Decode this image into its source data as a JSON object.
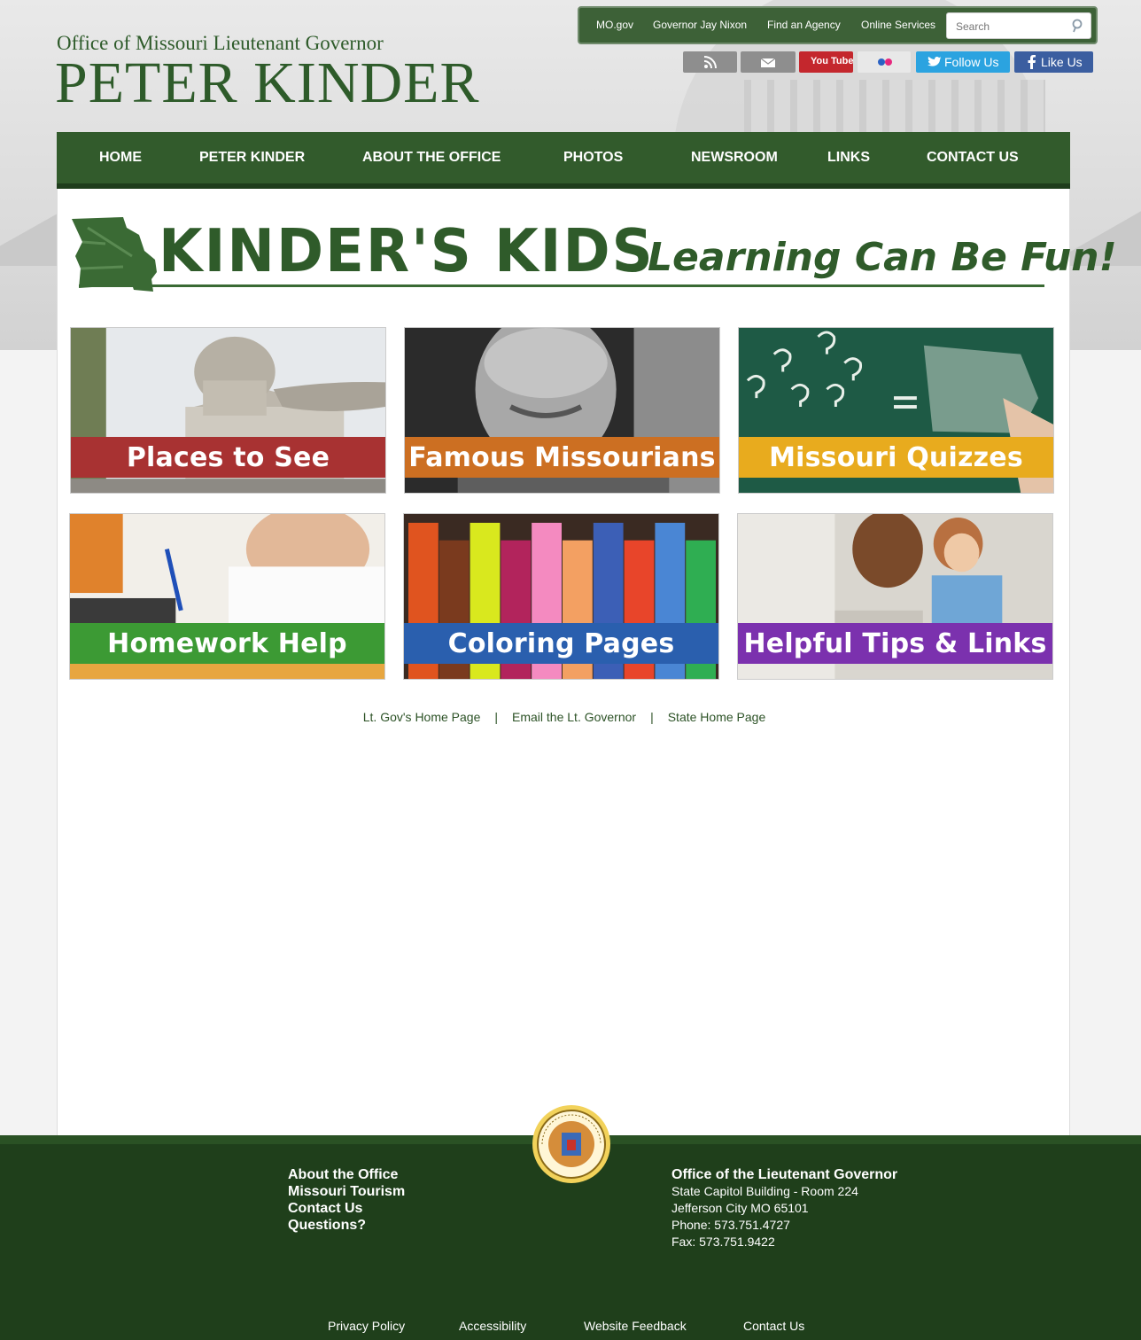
{
  "header": {
    "office_line": "Office of Missouri Lieutenant Governor",
    "name": "PETER KINDER",
    "utility_links": [
      "MO.gov",
      "Governor Jay Nixon",
      "Find an Agency",
      "Online Services"
    ],
    "search_placeholder": "Search",
    "social": {
      "rss": "rss-icon",
      "email": "email-icon",
      "youtube": "You Tube",
      "flickr": "flickr-icon",
      "twitter": "Follow Us",
      "facebook": "Like Us"
    }
  },
  "nav": [
    "HOME",
    "PETER KINDER",
    "ABOUT THE OFFICE",
    "PHOTOS",
    "NEWSROOM",
    "LINKS",
    "CONTACT US"
  ],
  "banner": {
    "title": "KINDER'S KIDS",
    "tagline": "Learning Can Be Fun!"
  },
  "tiles": [
    {
      "label": "Places to See",
      "color": "#a83232"
    },
    {
      "label": "Famous Missourians",
      "color": "#cc6f22"
    },
    {
      "label": "Missouri Quizzes",
      "color": "#e8ab1e"
    },
    {
      "label": "Homework Help",
      "color": "#3c9a34"
    },
    {
      "label": "Coloring Pages",
      "color": "#2a5fae"
    },
    {
      "label": "Helpful Tips & Links",
      "color": "#7b31ae"
    }
  ],
  "bottom_links": [
    "Lt. Gov's Home Page",
    "Email the Lt. Governor",
    "State Home Page"
  ],
  "bottom_links_separator": "|",
  "footer": {
    "left_links": [
      "About the Office",
      "Missouri Tourism",
      "Contact Us",
      "Questions?"
    ],
    "address_title": "Office of the Lieutenant Governor",
    "address_lines": [
      "State Capitol Building - Room 224",
      "Jefferson City MO 65101",
      "Phone: 573.751.4727",
      "Fax: 573.751.9422"
    ],
    "seal": "state-seal-icon",
    "bottom_links": [
      "Privacy Policy",
      "Accessibility",
      "Website Feedback",
      "Contact Us"
    ]
  }
}
